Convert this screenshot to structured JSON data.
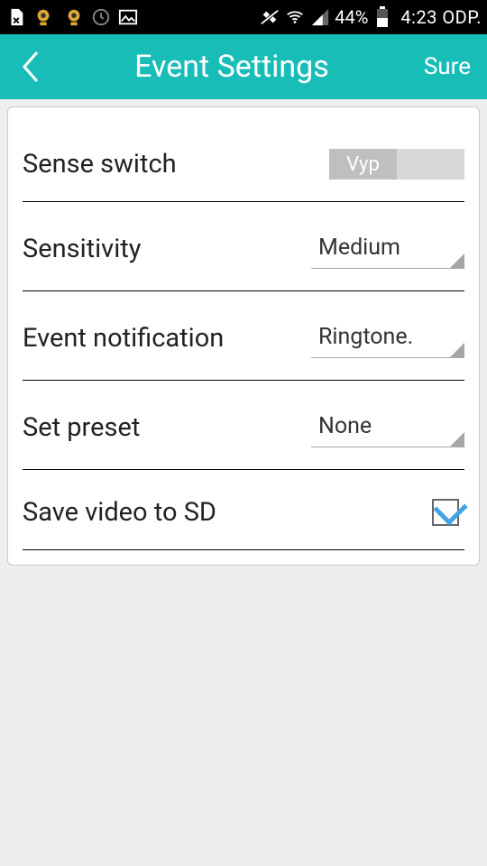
{
  "status_bar": {
    "battery_pct": "44%",
    "time": "4:23 ODP."
  },
  "header": {
    "title": "Event Settings",
    "action": "Sure"
  },
  "settings": {
    "sense_switch": {
      "label": "Sense switch",
      "value": "Vyp"
    },
    "sensitivity": {
      "label": "Sensitivity",
      "value": "Medium"
    },
    "event_notification": {
      "label": "Event notification",
      "value": "Ringtone."
    },
    "set_preset": {
      "label": "Set preset",
      "value": "None"
    },
    "save_video": {
      "label": "Save video to SD",
      "checked": true
    }
  }
}
